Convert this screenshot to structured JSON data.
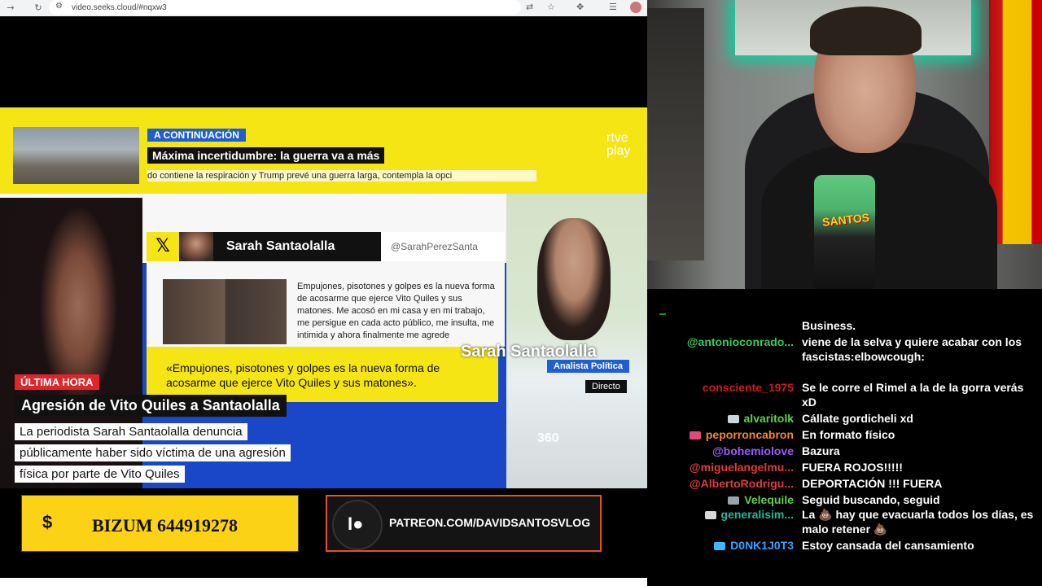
{
  "browser": {
    "url": "video.seeks.cloud/#nqxw3"
  },
  "banner": {
    "next_label": "A CONTINUACIÓN",
    "headline": "Máxima incertidumbre: la guerra va a más",
    "ticker": "do contiene la respiración y Trump prevé una guerra larga, contempla la opci",
    "logo_top": "rtve",
    "logo_bottom": "play"
  },
  "post": {
    "author": "Sarah Santaolalla",
    "handle": "@SarahPerezSanta",
    "body": "Empujones, pisotones y golpes es la nueva forma de acosarme que ejerce Vito Quiles y sus matones. Me acosó en mi casa y en mi trabajo, me persigue en cada acto público, me insulta, me intimida y ahora finalmente me agrede",
    "quote": "«Empujones, pisotones y golpes es la nueva forma de acosarme que ejerce Vito Quiles y sus matones»."
  },
  "reporter": {
    "name": "Sarah Santaolalla",
    "role": "Analista Política",
    "status": "Directo",
    "logo": "360"
  },
  "lower_third": {
    "breaking": "ÚLTIMA HORA",
    "title": "Agresión de Vito Quiles a Santaolalla",
    "lines": [
      "La periodista Sarah Santaolalla denuncia",
      "públicamente haber sido víctima de una agresión",
      "física por parte de Vito Quiles"
    ]
  },
  "donations": {
    "bizum_symbol": "$",
    "bizum": "BIZUM 644919278",
    "patreon": "PATREON.COM/DAVIDSANTOSVLOG"
  },
  "webcam": {
    "mic_label": "SANTOS"
  },
  "chat": {
    "messages": [
      {
        "user": "",
        "user_color": "#ffffff",
        "text": "Business."
      },
      {
        "user": "@antonioconrado...",
        "user_color": "#2ecf5a",
        "text": "viene de la selva y quiere acabar con los fascistas:elbowcough:"
      },
      {
        "user": "consciente_1975",
        "user_color": "#d11818",
        "text": "Se le corre el Rimel a la de la gorra verás xD"
      },
      {
        "user": "alvaritolk",
        "user_color": "#5ed14a",
        "text": "Cállate gordicheli xd",
        "badge": "diamond-icon"
      },
      {
        "user": "peporroncabron",
        "user_color": "#f08a2a",
        "text": "En formato físico",
        "badge": "envelope-icon"
      },
      {
        "user": "@bohemiolove",
        "user_color": "#9b5cff",
        "text": "Bazura"
      },
      {
        "user": "@miguelangelmu...",
        "user_color": "#e03a3a",
        "text": "FUERA ROJOS!!!!!"
      },
      {
        "user": "@AlbertoRodrigu...",
        "user_color": "#e03a3a",
        "text": "DEPORTACIÓN !!! FUERA"
      },
      {
        "user": "Velequile",
        "user_color": "#5ed14a",
        "text": "Seguid buscando, seguid",
        "badge": "tools-icon"
      },
      {
        "user": "generalisim...",
        "user_color": "#22b8a0",
        "text": "La 💩 hay que evacuarla todos los días, es malo retener 💩",
        "badge": "eye-icon"
      },
      {
        "user": "D0NK1J0T3",
        "user_color": "#3aa0ff",
        "text": "Estoy cansada del cansamiento",
        "badge": "crown-icon"
      }
    ]
  }
}
